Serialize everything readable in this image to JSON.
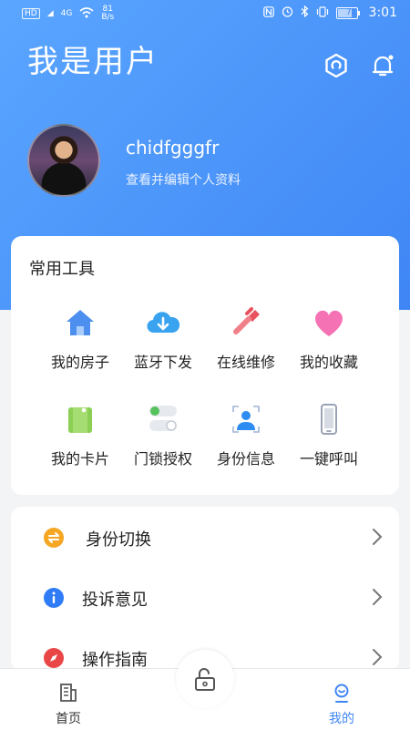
{
  "status_bar": {
    "network_labels": [
      "HD",
      "4G"
    ],
    "speed_value": "81",
    "speed_unit": "B/s",
    "battery": "71",
    "time": "3:01"
  },
  "header": {
    "title": "我是用户",
    "settings_icon": "hexagon-settings-icon",
    "notification_icon": "bell-icon"
  },
  "profile": {
    "username": "chidfgggfr",
    "edit_label": "查看并编辑个人资料"
  },
  "tools": {
    "title": "常用工具",
    "items": [
      {
        "label": "我的房子",
        "icon": "house-icon"
      },
      {
        "label": "蓝牙下发",
        "icon": "cloud-download-icon"
      },
      {
        "label": "在线维修",
        "icon": "wrench-icon"
      },
      {
        "label": "我的收藏",
        "icon": "heart-icon"
      },
      {
        "label": "我的卡片",
        "icon": "card-icon"
      },
      {
        "label": "门锁授权",
        "icon": "toggle-icon"
      },
      {
        "label": "身份信息",
        "icon": "id-person-icon"
      },
      {
        "label": "一键呼叫",
        "icon": "phone-icon"
      }
    ]
  },
  "menu": {
    "items": [
      {
        "label": "身份切换",
        "icon": "switch-icon"
      },
      {
        "label": "投诉意见",
        "icon": "info-icon"
      },
      {
        "label": "操作指南",
        "icon": "compass-icon"
      }
    ]
  },
  "tabbar": {
    "items": [
      {
        "label": "首页",
        "icon": "building-icon",
        "active": false
      },
      {
        "label": "我的",
        "icon": "profile-icon",
        "active": true
      }
    ],
    "center_icon": "unlock-icon"
  },
  "colors": {
    "primary": "#3f86f5",
    "active_tab": "#3f86f5",
    "inactive_tab": "#333333"
  }
}
